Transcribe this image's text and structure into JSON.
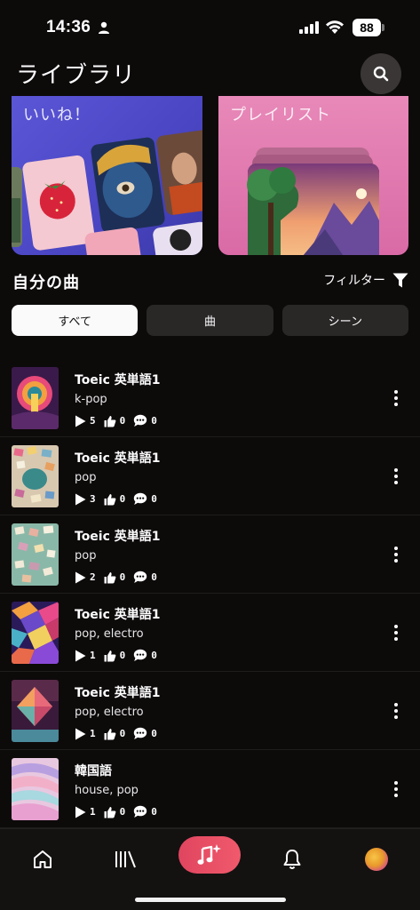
{
  "status_bar": {
    "time": "14:36",
    "battery": "88"
  },
  "header": {
    "title": "ライブラリ"
  },
  "cards": {
    "liked_label": "いいね！",
    "playlist_label": "プレイリスト"
  },
  "section": {
    "title": "自分の曲",
    "filter_label": "フィルター"
  },
  "tabs": [
    {
      "label": "すべて",
      "active": true
    },
    {
      "label": "曲",
      "active": false
    },
    {
      "label": "シーン",
      "active": false
    }
  ],
  "songs": [
    {
      "title": "Toeic 英単語1",
      "genre": "k-pop",
      "plays": "5",
      "likes": "0",
      "comments": "0",
      "thumb": "retro-sunset"
    },
    {
      "title": "Toeic 英単語1",
      "genre": "pop",
      "plays": "3",
      "likes": "0",
      "comments": "0",
      "thumb": "paper-mosaic"
    },
    {
      "title": "Toeic 英単語1",
      "genre": "pop",
      "plays": "2",
      "likes": "0",
      "comments": "0",
      "thumb": "paper-mosaic-teal"
    },
    {
      "title": "Toeic 英単語1",
      "genre": "pop, electro",
      "plays": "1",
      "likes": "0",
      "comments": "0",
      "thumb": "geometric"
    },
    {
      "title": "Toeic 英単語1",
      "genre": "pop, electro",
      "plays": "1",
      "likes": "0",
      "comments": "0",
      "thumb": "diamond"
    },
    {
      "title": "韓国語",
      "genre": "house, pop",
      "plays": "1",
      "likes": "0",
      "comments": "0",
      "thumb": "pastel-swirl"
    }
  ],
  "nav": {
    "items": [
      "home-icon",
      "library-icon",
      "create-music-icon",
      "bell-icon",
      "avatar"
    ]
  },
  "colors": {
    "background": "#0d0a0a",
    "accent": "#e8475f",
    "liked_card": "#5a56d6",
    "playlist_card": "#e889b9"
  }
}
